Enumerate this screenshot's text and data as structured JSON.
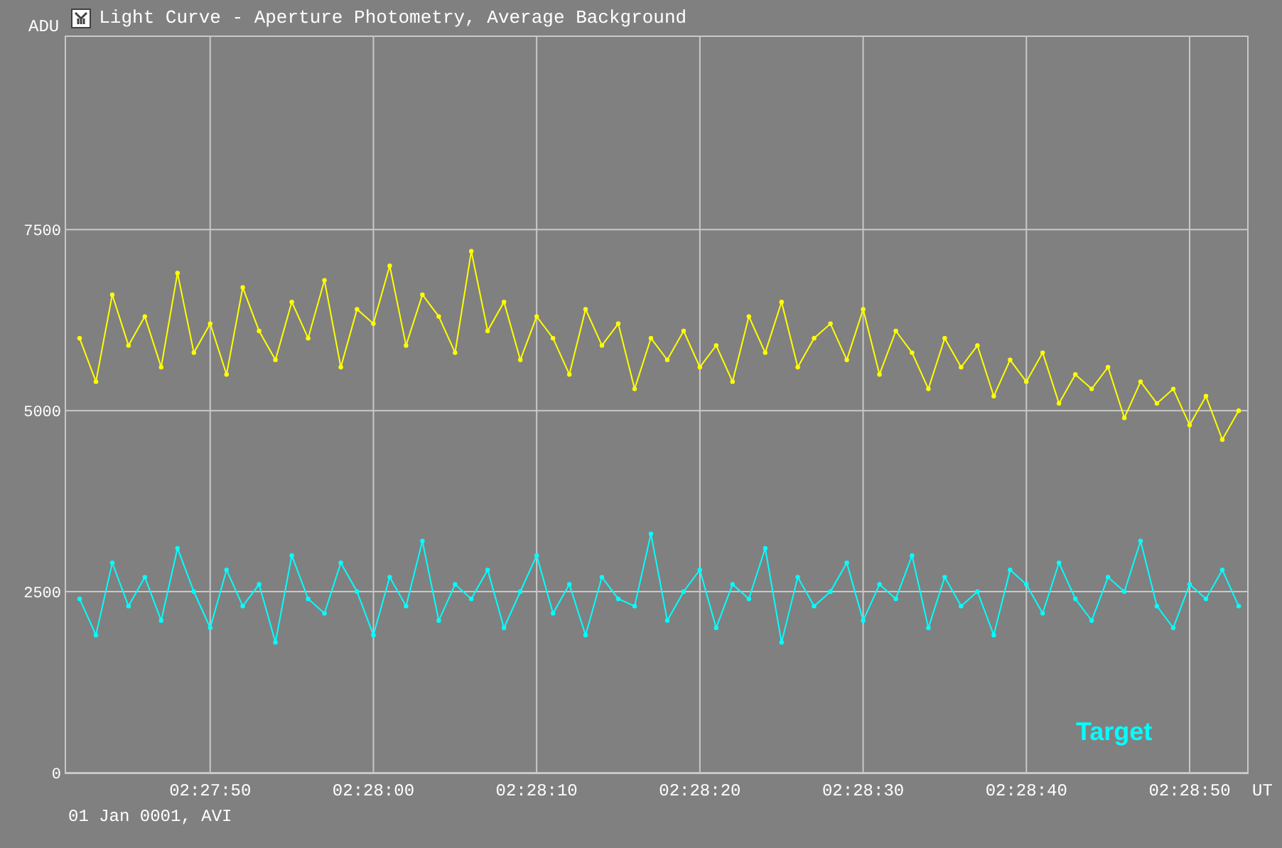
{
  "chart_data": {
    "type": "line",
    "title": "Light Curve - Aperture Photometry, Average Background",
    "xlabel": "UT",
    "ylabel": "ADU",
    "x": [
      8862,
      8863,
      8864,
      8865,
      8866,
      8867,
      8868,
      8869,
      8870,
      8871,
      8872,
      8873,
      8874,
      8875,
      8876,
      8877,
      8878,
      8879,
      8880,
      8881,
      8882,
      8883,
      8884,
      8885,
      8886,
      8887,
      8888,
      8889,
      8890,
      8891,
      8892,
      8893,
      8894,
      8895,
      8896,
      8897,
      8898,
      8899,
      8900,
      8901,
      8902,
      8903,
      8904,
      8905,
      8906,
      8907,
      8908,
      8909,
      8910,
      8911,
      8912,
      8913,
      8914,
      8915,
      8916,
      8917,
      8918,
      8919,
      8920,
      8921,
      8922,
      8923,
      8924,
      8925,
      8926,
      8927,
      8928,
      8929,
      8930,
      8931,
      8932,
      8933
    ],
    "xlim": [
      8861.13,
      8933.57
    ],
    "ylim": [
      0,
      10180
    ],
    "grid": true,
    "xticks": [
      {
        "value": 8870,
        "label": "02:27:50"
      },
      {
        "value": 8880,
        "label": "02:28:00"
      },
      {
        "value": 8890,
        "label": "02:28:10"
      },
      {
        "value": 8900,
        "label": "02:28:20"
      },
      {
        "value": 8910,
        "label": "02:28:30"
      },
      {
        "value": 8920,
        "label": "02:28:40"
      },
      {
        "value": 8930,
        "label": "02:28:50"
      }
    ],
    "yticks": [
      0,
      2500,
      5000,
      7500
    ],
    "series": [
      {
        "color": "#ffff00",
        "values": [
          6000,
          5400,
          6600,
          5900,
          6300,
          5600,
          6900,
          5800,
          6200,
          5500,
          6700,
          6100,
          5700,
          6500,
          6000,
          6800,
          5600,
          6400,
          6200,
          7000,
          5900,
          6600,
          6300,
          5800,
          7200,
          6100,
          6500,
          5700,
          6300,
          6000,
          5500,
          6400,
          5900,
          6200,
          5300,
          6000,
          5700,
          6100,
          5600,
          5900,
          5400,
          6300,
          5800,
          6500,
          5600,
          6000,
          6200,
          5700,
          6400,
          5500,
          6100,
          5800,
          5300,
          6000,
          5600,
          5900,
          5200,
          5700,
          5400,
          5800,
          5100,
          5500,
          5300,
          5600,
          4900,
          5400,
          5100,
          5300,
          4800,
          5200,
          4600,
          5000
        ]
      },
      {
        "name": "Target",
        "color": "#00ffff",
        "values": [
          2400,
          1900,
          2900,
          2300,
          2700,
          2100,
          3100,
          2500,
          2000,
          2800,
          2300,
          2600,
          1800,
          3000,
          2400,
          2200,
          2900,
          2500,
          1900,
          2700,
          2300,
          3200,
          2100,
          2600,
          2400,
          2800,
          2000,
          2500,
          3000,
          2200,
          2600,
          1900,
          2700,
          2400,
          2300,
          3300,
          2100,
          2500,
          2800,
          2000,
          2600,
          2400,
          3100,
          1800,
          2700,
          2300,
          2500,
          2900,
          2100,
          2600,
          2400,
          3000,
          2000,
          2700,
          2300,
          2500,
          1900,
          2800,
          2600,
          2200,
          2900,
          2400,
          2100,
          2700,
          2500,
          3200,
          2300,
          2000,
          2600,
          2400,
          2800,
          2300
        ]
      }
    ]
  },
  "footer": "01 Jan 0001, AVI"
}
